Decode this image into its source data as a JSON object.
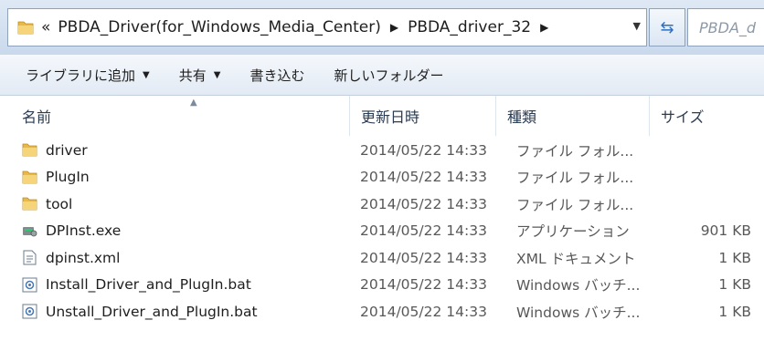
{
  "address_bar": {
    "overflow_chevron": "«",
    "crumbs": [
      "PBDA_Driver(for_Windows_Media_Center)",
      "PBDA_driver_32"
    ],
    "search_placeholder": "PBDA_d"
  },
  "toolbar": {
    "add_to_library": "ライブラリに追加",
    "share": "共有",
    "burn": "書き込む",
    "new_folder": "新しいフォルダー"
  },
  "columns": {
    "name": "名前",
    "date": "更新日時",
    "type": "種類",
    "size": "サイズ"
  },
  "files": [
    {
      "name": "driver",
      "date": "2014/05/22 14:33",
      "type": "ファイル フォル...",
      "size": "",
      "icon": "folder-icon"
    },
    {
      "name": "PlugIn",
      "date": "2014/05/22 14:33",
      "type": "ファイル フォル...",
      "size": "",
      "icon": "folder-icon"
    },
    {
      "name": "tool",
      "date": "2014/05/22 14:33",
      "type": "ファイル フォル...",
      "size": "",
      "icon": "folder-icon"
    },
    {
      "name": "DPInst.exe",
      "date": "2014/05/22 14:33",
      "type": "アプリケーション",
      "size": "901 KB",
      "icon": "exe-icon"
    },
    {
      "name": "dpinst.xml",
      "date": "2014/05/22 14:33",
      "type": "XML ドキュメント",
      "size": "1 KB",
      "icon": "xml-file-icon"
    },
    {
      "name": "Install_Driver_and_PlugIn.bat",
      "date": "2014/05/22 14:33",
      "type": "Windows バッチ...",
      "size": "1 KB",
      "icon": "batch-file-icon"
    },
    {
      "name": "Unstall_Driver_and_PlugIn.bat",
      "date": "2014/05/22 14:33",
      "type": "Windows バッチ...",
      "size": "1 KB",
      "icon": "batch-file-icon"
    }
  ]
}
